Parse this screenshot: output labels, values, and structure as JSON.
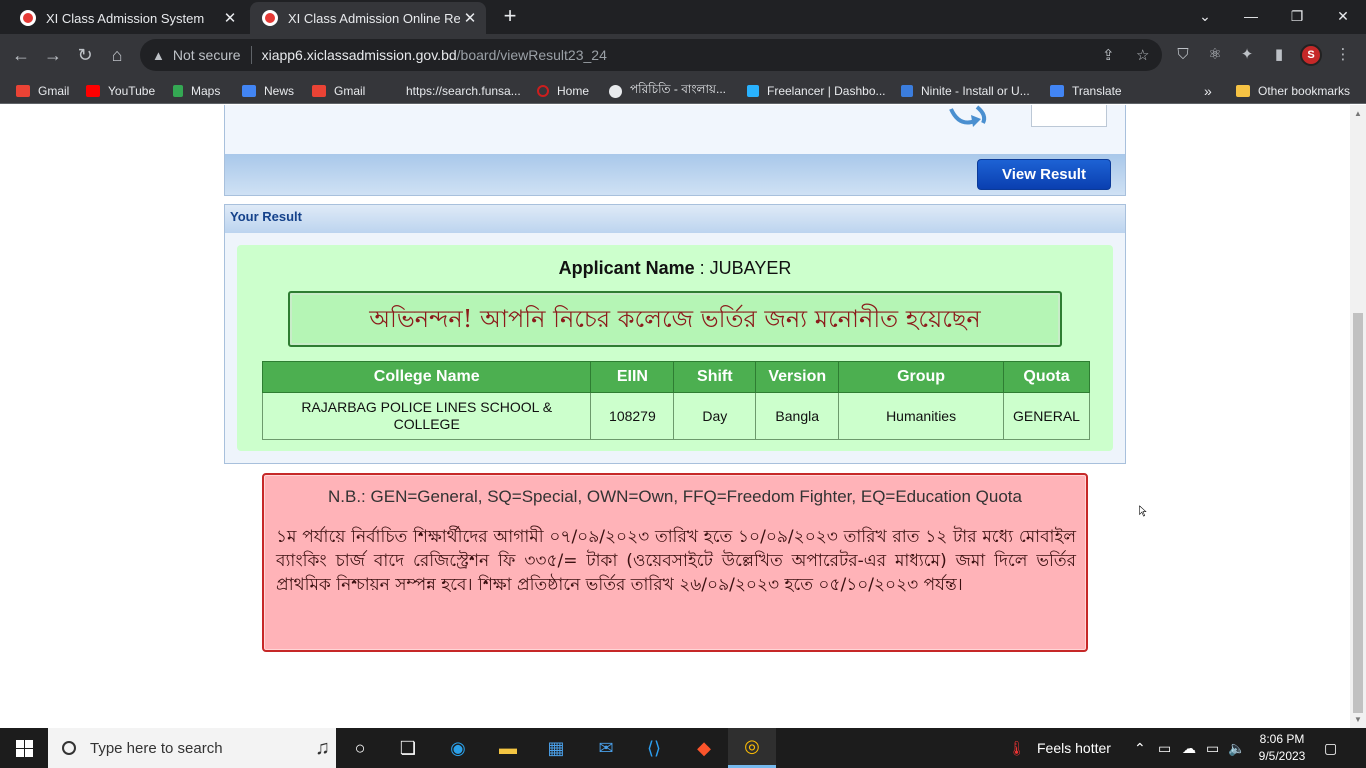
{
  "browser": {
    "tabs": [
      {
        "title": "XI Class Admission System",
        "active": false
      },
      {
        "title": "XI Class Admission Online Result",
        "active": true
      }
    ],
    "address": {
      "security_label": "Not secure",
      "host": "xiapp6.xiclassadmission.gov.bd",
      "path": "/board/viewResult23_24"
    },
    "bookmarks": [
      {
        "label": "Gmail",
        "icon": "gmail-icon",
        "color": "#ea4335"
      },
      {
        "label": "YouTube",
        "icon": "youtube-icon",
        "color": "#ff0000"
      },
      {
        "label": "Maps",
        "icon": "maps-icon",
        "color": "#34a853"
      },
      {
        "label": "News",
        "icon": "news-icon",
        "color": "#4285f4"
      },
      {
        "label": "Gmail",
        "icon": "gmail-icon",
        "color": "#ea4335"
      },
      {
        "label": "https://search.funsa...",
        "icon": "blank-icon",
        "color": "#35363a"
      },
      {
        "label": "Home",
        "icon": "opera-icon",
        "color": "#cc1e1e"
      },
      {
        "label": "পরিচিতি - বাংলায়...",
        "icon": "globe-icon",
        "color": "#e8eaed"
      },
      {
        "label": "Freelancer | Dashbo...",
        "icon": "freelancer-icon",
        "color": "#29b2fe"
      },
      {
        "label": "Ninite - Install or U...",
        "icon": "ninite-icon",
        "color": "#3b7ddd"
      },
      {
        "label": "Translate",
        "icon": "translate-icon",
        "color": "#4285f4"
      }
    ],
    "other_bookmarks": "Other bookmarks"
  },
  "page": {
    "view_result_button": "View Result",
    "result_header": "Your Result",
    "applicant_label": "Applicant Name",
    "applicant_name": ": JUBAYER",
    "congrats_message": "অভিনন্দন! আপনি নিচের কলেজে ভর্তির জন্য মনোনীত হয়েছেন",
    "table": {
      "headers": [
        "College Name",
        "EIIN",
        "Shift",
        "Version",
        "Group",
        "Quota"
      ],
      "rows": [
        [
          "RAJARBAG POLICE LINES SCHOOL & COLLEGE",
          "108279",
          "Day",
          "Bangla",
          "Humanities",
          "GENERAL"
        ]
      ]
    },
    "notice": {
      "nb": "N.B.: GEN=General, SQ=Special, OWN=Own, FFQ=Freedom Fighter, EQ=Education Quota",
      "bangla": "১ম পর্যায়ে নির্বাচিত শিক্ষার্থীদের আগামী ০৭/০৯/২০২৩ তারিখ হতে ১০/০৯/২০২৩ তারিখ রাত ১২ টার মধ্যে মোবাইল ব্যাংকিং চার্জ বাদে রেজিস্ট্রেশন ফি ৩৩৫/= টাকা (ওয়েবসাইটে উল্লেখিত অপারেটর-এর মাধ্যমে) জমা দিলে ভর্তির প্রাথমিক নিশ্চায়ন সম্পন্ন হবে। শিক্ষা প্রতিষ্ঠানে ভর্তির তারিখ ২৬/০৯/২০২৩ হতে ০৫/১০/২০২৩ পর্যন্ত।"
    }
  },
  "taskbar": {
    "search_placeholder": "Type here to search",
    "weather": "Feels hotter",
    "time": "8:06 PM",
    "date": "9/5/2023"
  }
}
